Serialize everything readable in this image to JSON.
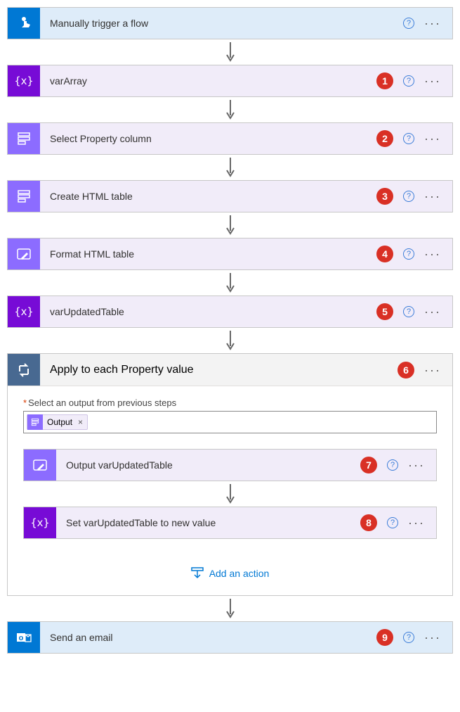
{
  "steps": {
    "trigger": {
      "title": "Manually trigger a flow"
    },
    "s1": {
      "title": "varArray",
      "badge": "1"
    },
    "s2": {
      "title": "Select Property column",
      "badge": "2"
    },
    "s3": {
      "title": "Create HTML table",
      "badge": "3"
    },
    "s4": {
      "title": "Format HTML table",
      "badge": "4"
    },
    "s5": {
      "title": "varUpdatedTable",
      "badge": "5"
    },
    "loop": {
      "title": "Apply to each Property value",
      "badge": "6",
      "fieldLabel": "Select an output from previous steps",
      "tokenLabel": "Output",
      "inner7": {
        "title": "Output varUpdatedTable",
        "badge": "7"
      },
      "inner8": {
        "title": "Set varUpdatedTable to new value",
        "badge": "8"
      },
      "addAction": "Add an action"
    },
    "s9": {
      "title": "Send an email",
      "badge": "9"
    }
  }
}
